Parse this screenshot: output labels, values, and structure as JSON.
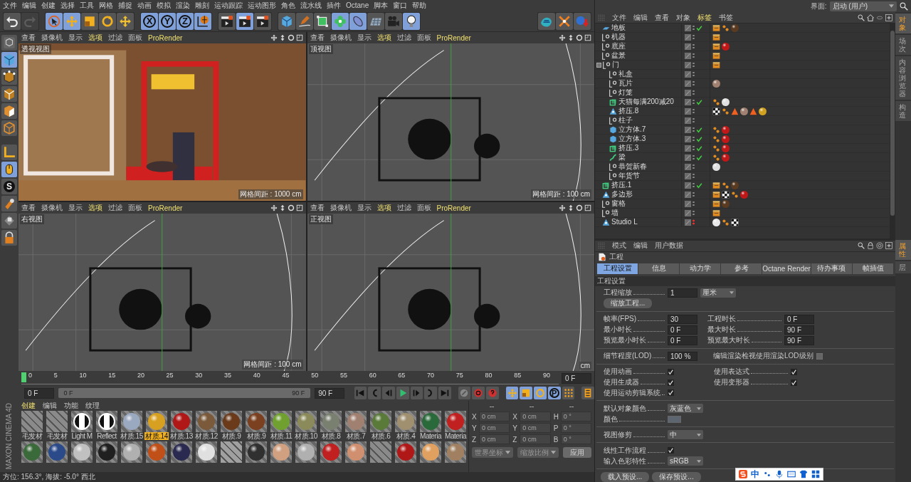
{
  "menu": [
    "文件",
    "编辑",
    "创建",
    "选择",
    "工具",
    "网格",
    "捕捉",
    "动画",
    "模拟",
    "渲染",
    "雕刻",
    "运动跟踪",
    "运动图形",
    "角色",
    "流水线",
    "插件",
    "Octane",
    "脚本",
    "窗口",
    "帮助"
  ],
  "toolbar": [
    {
      "items": [
        {
          "kind": "undo",
          "selected": false,
          "disabled": false
        },
        {
          "kind": "redo",
          "selected": false,
          "disabled": true
        }
      ]
    },
    {
      "items": [
        {
          "kind": "cursor",
          "selected": true,
          "disabled": false
        },
        {
          "kind": "move",
          "selected": true,
          "disabled": false
        },
        {
          "kind": "scale",
          "selected": false,
          "disabled": false
        },
        {
          "kind": "rotate",
          "selected": false,
          "disabled": false
        },
        {
          "kind": "transform",
          "selected": false,
          "disabled": false
        }
      ]
    },
    {
      "items": [
        {
          "kind": "axis",
          "label": "X",
          "selected": true,
          "disabled": false
        },
        {
          "kind": "axis",
          "label": "Y",
          "selected": true,
          "disabled": false
        },
        {
          "kind": "axis",
          "label": "Z",
          "selected": true,
          "disabled": false
        },
        {
          "kind": "world",
          "selected": true,
          "disabled": false
        }
      ]
    },
    {
      "items": [
        {
          "kind": "clapper",
          "selected": false,
          "disabled": false
        },
        {
          "kind": "clapper",
          "selected": true,
          "disabled": false
        },
        {
          "kind": "clapper",
          "selected": false,
          "disabled": false
        }
      ]
    },
    {
      "items": [
        {
          "kind": "cube",
          "selected": false,
          "disabled": false
        },
        {
          "kind": "pen",
          "selected": false,
          "disabled": false
        },
        {
          "kind": "subdiv",
          "selected": false,
          "disabled": false
        },
        {
          "kind": "cloner",
          "selected": true,
          "disabled": false
        },
        {
          "kind": "deformer",
          "selected": true,
          "disabled": false
        },
        {
          "kind": "floor",
          "selected": false,
          "disabled": false
        },
        {
          "kind": "camera",
          "selected": false,
          "disabled": false
        },
        {
          "kind": "bulb",
          "selected": true,
          "disabled": false
        }
      ]
    },
    {
      "items": [
        {
          "kind": "blob",
          "selected": false,
          "disabled": false
        },
        {
          "kind": "snap",
          "selected": false,
          "disabled": false
        },
        {
          "kind": "spherearrow",
          "selected": false,
          "disabled": false
        }
      ]
    }
  ],
  "left_tools": [
    {
      "kind": "viewcube",
      "selected": false
    },
    {
      "kind": "cube",
      "selected": true
    },
    {
      "kind": "points",
      "selected": false
    },
    {
      "kind": "edges",
      "selected": false
    },
    {
      "kind": "polys",
      "selected": false
    },
    {
      "kind": "uvcube",
      "selected": false
    },
    {
      "kind": "axis",
      "selected": false
    },
    {
      "kind": "mouse",
      "selected": true
    },
    {
      "kind": "snap",
      "label": "S",
      "selected": false
    },
    {
      "kind": "magnet",
      "selected": false
    },
    {
      "kind": "lockgrid",
      "selected": false
    },
    {
      "kind": "lock",
      "selected": false
    }
  ],
  "viewports": [
    {
      "title": "透视视图",
      "grid": "网格间距 : 1000 cm",
      "kind": "render",
      "menu": [
        {
          "label": "查看",
          "highlighted": false
        },
        {
          "label": "摄像机",
          "highlighted": false
        },
        {
          "label": "显示",
          "highlighted": false
        },
        {
          "label": "选项",
          "highlighted": true
        },
        {
          "label": "过滤",
          "highlighted": false
        },
        {
          "label": "面板",
          "highlighted": false
        },
        {
          "label": "ProRender",
          "highlighted": true
        }
      ]
    },
    {
      "title": "顶视图",
      "grid": "网格间距 : 100 cm",
      "kind": "wireframe",
      "menu": [
        {
          "label": "查看",
          "highlighted": false
        },
        {
          "label": "摄像机",
          "highlighted": false
        },
        {
          "label": "显示",
          "highlighted": false
        },
        {
          "label": "选项",
          "highlighted": true
        },
        {
          "label": "过滤",
          "highlighted": false
        },
        {
          "label": "面板",
          "highlighted": false
        },
        {
          "label": "ProRender",
          "highlighted": true
        }
      ]
    },
    {
      "title": "右视图",
      "grid": "网格间距 : 100 cm",
      "kind": "wireframe",
      "menu": [
        {
          "label": "查看",
          "highlighted": false
        },
        {
          "label": "摄像机",
          "highlighted": false
        },
        {
          "label": "显示",
          "highlighted": false
        },
        {
          "label": "选项",
          "highlighted": true
        },
        {
          "label": "过滤",
          "highlighted": false
        },
        {
          "label": "面板",
          "highlighted": false
        },
        {
          "label": "ProRender",
          "highlighted": true
        }
      ]
    },
    {
      "title": "正视图",
      "grid": "cm",
      "kind": "wireframe",
      "menu": [
        {
          "label": "查看",
          "highlighted": false
        },
        {
          "label": "摄像机",
          "highlighted": false
        },
        {
          "label": "显示",
          "highlighted": false
        },
        {
          "label": "选项",
          "highlighted": true
        },
        {
          "label": "过滤",
          "highlighted": false
        },
        {
          "label": "面板",
          "highlighted": false
        },
        {
          "label": "ProRender",
          "highlighted": true
        }
      ]
    }
  ],
  "timeline": {
    "ticks": [
      "0",
      "5",
      "10",
      "15",
      "20",
      "25",
      "30",
      "35",
      "40",
      "45",
      "50",
      "55",
      "60",
      "65",
      "70",
      "75",
      "80",
      "85",
      "90"
    ],
    "playhead": {
      "level": 0
    },
    "current": "0 F"
  },
  "transport": {
    "start": "0 F",
    "range_start": "0 F",
    "range_end": "90 F",
    "level": 1,
    "end": "90 F",
    "buttons": [
      {
        "kind": "first",
        "selected": false
      },
      {
        "kind": "prevkey",
        "selected": false
      },
      {
        "kind": "prevframe",
        "selected": false
      },
      {
        "kind": "play",
        "selected": false
      },
      {
        "kind": "nextframe",
        "selected": false
      },
      {
        "kind": "nextkey",
        "selected": false
      },
      {
        "kind": "last",
        "selected": false
      },
      {
        "kind": "recordoff",
        "selected": false
      },
      {
        "kind": "record",
        "selected": false
      },
      {
        "kind": "keyhelp",
        "selected": false
      },
      {
        "kind": "move",
        "selected": true
      },
      {
        "kind": "scale",
        "selected": true
      },
      {
        "kind": "rotate",
        "selected": true
      },
      {
        "kind": "param",
        "label": "P",
        "selected": true
      },
      {
        "kind": "dots",
        "selected": false
      },
      {
        "kind": "timeline",
        "selected": false
      }
    ]
  },
  "materials": {
    "menu": [
      {
        "label": "创建",
        "highlighted": true
      },
      {
        "label": "编辑",
        "highlighted": false
      },
      {
        "label": "功能",
        "highlighted": false
      },
      {
        "label": "纹理",
        "highlighted": false
      }
    ],
    "row_1": [
      {
        "name": "毛发材",
        "kind": "hair",
        "color": "#8a8a8a",
        "selected": false
      },
      {
        "name": "毛发材",
        "kind": "hair",
        "color": "#8a8a8a",
        "selected": false
      },
      {
        "name": "Light M",
        "kind": "bw",
        "color": "#ffffff",
        "selected": false
      },
      {
        "name": "Reflect",
        "kind": "bw",
        "color": "#ffffff",
        "selected": false
      },
      {
        "name": "材质.15",
        "kind": "sphere",
        "color": "#9aa8c0",
        "selected": false
      },
      {
        "name": "材质.14",
        "kind": "sphere",
        "color": "#d8a020",
        "selected": true
      },
      {
        "name": "材质.13",
        "kind": "sphere",
        "color": "#b01818",
        "selected": false
      },
      {
        "name": "材质.12",
        "kind": "sphere",
        "color": "#7a5a3a",
        "selected": false
      },
      {
        "name": "材质.9",
        "kind": "sphere",
        "color": "#6a3a1a",
        "selected": false
      },
      {
        "name": "材质.9",
        "kind": "sphere",
        "color": "#7a4020",
        "selected": false
      },
      {
        "name": "材质.11",
        "kind": "sphere",
        "color": "#70a030",
        "selected": false
      },
      {
        "name": "材质.10",
        "kind": "sphere",
        "color": "#8a8a5a",
        "selected": false
      },
      {
        "name": "材质.8",
        "kind": "sphere",
        "color": "#7a8070",
        "selected": false
      },
      {
        "name": "材质.7",
        "kind": "sphere",
        "color": "#a08070",
        "selected": false
      },
      {
        "name": "材质.6",
        "kind": "sphere",
        "color": "#5a7a3a",
        "selected": false
      },
      {
        "name": "材质.4",
        "kind": "sphere",
        "color": "#a09070",
        "selected": false
      },
      {
        "name": "Materia",
        "kind": "sphere",
        "color": "#2a6a3a",
        "selected": false
      },
      {
        "name": "Materia",
        "kind": "sphere",
        "color": "#c02020",
        "selected": false
      }
    ],
    "row_2": [
      {
        "kind": "sphere",
        "color": "#3a6a3a"
      },
      {
        "kind": "sphere",
        "color": "#2a4a8a"
      },
      {
        "kind": "sphere",
        "color": "#c0c0c0"
      },
      {
        "kind": "sphere",
        "color": "#202020"
      },
      {
        "kind": "sphere",
        "color": "#b0b0b0"
      },
      {
        "kind": "sphere",
        "color": "#c05018"
      },
      {
        "kind": "sphere",
        "color": "#2a2a50"
      },
      {
        "kind": "sphere",
        "color": "#e0e0e0"
      },
      {
        "kind": "hair",
        "color": "#a0a0a0"
      },
      {
        "kind": "sphere",
        "color": "#303030"
      },
      {
        "kind": "sphere",
        "color": "#d0a080"
      },
      {
        "kind": "sphere",
        "color": "#b0b0b0"
      },
      {
        "kind": "sphere",
        "color": "#c02020"
      },
      {
        "kind": "sphere",
        "color": "#d09070"
      },
      {
        "kind": "hair",
        "color": "#8a8a8a"
      },
      {
        "kind": "sphere",
        "color": "#b01818"
      },
      {
        "kind": "sphere",
        "color": "#e0a060"
      },
      {
        "kind": "sphere",
        "color": "#a08060"
      }
    ]
  },
  "coordinates": {
    "headers": [
      "--",
      "--",
      "--"
    ],
    "rows": [
      [
        {
          "axis": "X",
          "value": "0 cm"
        },
        {
          "axis": "X",
          "value": "0 cm"
        },
        {
          "axis": "H",
          "value": "0 °"
        }
      ],
      [
        {
          "axis": "Y",
          "value": "0 cm"
        },
        {
          "axis": "Y",
          "value": "0 cm"
        },
        {
          "axis": "P",
          "value": "0 °"
        }
      ],
      [
        {
          "axis": "Z",
          "value": "0 cm"
        },
        {
          "axis": "Z",
          "value": "0 cm"
        },
        {
          "axis": "B",
          "value": "0 °"
        }
      ]
    ],
    "mode": "世界坐标",
    "scale": "缩放比例",
    "apply": "应用"
  },
  "logo": "MAXON CINEMA 4D",
  "status_bar": "方位: 156.3°, 海拔: -5.0° 西北",
  "layout": {
    "label": "界面:",
    "value": "启动 (用户)"
  },
  "object_manager": {
    "menu": [
      {
        "label": "文件",
        "highlighted": false
      },
      {
        "label": "编辑",
        "highlighted": false
      },
      {
        "label": "查看",
        "highlighted": false
      },
      {
        "label": "对象",
        "highlighted": false
      },
      {
        "label": "标签",
        "highlighted": true
      },
      {
        "label": "书签",
        "highlighted": false
      }
    ],
    "objects": [
      {
        "name": "地板",
        "kind": "plane",
        "checked": true,
        "render_off": false,
        "tags": [
          {
            "kind": "clapper"
          },
          {
            "kind": "dots"
          },
          {
            "kind": "sphere",
            "color": "#5a3a20"
          }
        ]
      },
      {
        "name": "机器",
        "kind": "null",
        "checked": false,
        "render_off": false,
        "tags": [
          {
            "kind": "clapper"
          }
        ]
      },
      {
        "name": "底座",
        "kind": "null",
        "checked": false,
        "render_off": false,
        "tags": [
          {
            "kind": "clapper"
          },
          {
            "kind": "sphere",
            "color": "#c01818"
          }
        ]
      },
      {
        "name": "盆景",
        "kind": "null",
        "checked": false,
        "render_off": false,
        "tags": [
          {
            "kind": "clapper"
          }
        ]
      },
      {
        "name": "门",
        "kind": "null",
        "checked": false,
        "render_off": false,
        "tags": [
          {
            "kind": "clapper"
          }
        ],
        "expanded": true,
        "children": [
          {
            "name": "礼盒",
            "kind": "null",
            "checked": false,
            "render_off": false
          },
          {
            "name": "瓦片",
            "kind": "null",
            "checked": false,
            "render_off": false,
            "tags": [
              {
                "kind": "sphere",
                "color": "#a08070"
              }
            ]
          },
          {
            "name": "灯笼",
            "kind": "null",
            "checked": false,
            "render_off": false
          },
          {
            "name": "天猫每满200减20",
            "kind": "extrude",
            "checked": true,
            "render_off": false,
            "tags": [
              {
                "kind": "dots"
              },
              {
                "kind": "sphere",
                "color": "#e0e0e0"
              }
            ]
          },
          {
            "name": "挤压.8",
            "kind": "polygon",
            "checked": false,
            "render_off": false,
            "tags": [
              {
                "kind": "checker"
              },
              {
                "kind": "dots"
              },
              {
                "kind": "triangle"
              },
              {
                "kind": "sphere",
                "color": "#a08070"
              },
              {
                "kind": "triangle"
              },
              {
                "kind": "sphere",
                "color": "#d0a020"
              }
            ]
          },
          {
            "name": "柱子",
            "kind": "null",
            "checked": false,
            "render_off": false
          },
          {
            "name": "立方体.7",
            "kind": "cube",
            "checked": true,
            "render_off": false,
            "tags": [
              {
                "kind": "dots"
              },
              {
                "kind": "sphere",
                "color": "#c01818"
              }
            ]
          },
          {
            "name": "立方体.3",
            "kind": "cube",
            "checked": true,
            "render_off": false,
            "tags": [
              {
                "kind": "dots"
              },
              {
                "kind": "sphere",
                "color": "#c01818"
              }
            ]
          },
          {
            "name": "挤压.3",
            "kind": "extrude",
            "checked": true,
            "render_off": false,
            "tags": [
              {
                "kind": "dots"
              },
              {
                "kind": "sphere",
                "color": "#c01818"
              }
            ]
          },
          {
            "name": "梁",
            "kind": "spline",
            "checked": true,
            "render_off": false,
            "tags": [
              {
                "kind": "dots"
              },
              {
                "kind": "sphere",
                "color": "#c01818"
              }
            ]
          },
          {
            "name": "恭贺新春",
            "kind": "null",
            "checked": false,
            "render_off": false,
            "tags": [
              {
                "kind": "sphere",
                "color": "#e0e0e0"
              }
            ]
          },
          {
            "name": "年货节",
            "kind": "null",
            "checked": false,
            "render_off": false
          }
        ]
      },
      {
        "name": "挤压.1",
        "kind": "extrude",
        "checked": true,
        "render_off": false,
        "tags": [
          {
            "kind": "clapper"
          },
          {
            "kind": "dots"
          },
          {
            "kind": "sphere",
            "color": "#5a3a20"
          }
        ]
      },
      {
        "name": "多边形",
        "kind": "polygon",
        "checked": false,
        "render_off": false,
        "tags": [
          {
            "kind": "clapper"
          },
          {
            "kind": "checker"
          },
          {
            "kind": "dots"
          },
          {
            "kind": "sphere",
            "color": "#c01818"
          }
        ]
      },
      {
        "name": "窗格",
        "kind": "null",
        "checked": false,
        "render_off": false,
        "tags": [
          {
            "kind": "clapper"
          },
          {
            "kind": "sphere",
            "color": "#5a3a20"
          }
        ]
      },
      {
        "name": "墙",
        "kind": "null",
        "checked": false,
        "render_off": false,
        "tags": [
          {
            "kind": "clapper"
          }
        ]
      },
      {
        "name": "Studio L",
        "kind": "polygon",
        "checked": false,
        "render_off": true,
        "tags": [
          {
            "kind": "sphere",
            "color": "#e8e8e8"
          },
          {
            "kind": "dots"
          },
          {
            "kind": "checker"
          }
        ]
      }
    ],
    "side_tabs": [
      {
        "label": "对象",
        "selected": true
      },
      {
        "label": "场次",
        "selected": false
      },
      {
        "label": "内容浏览器",
        "selected": false
      },
      {
        "label": "构造",
        "selected": false
      }
    ]
  },
  "attributes": {
    "menu": [
      {
        "label": "模式",
        "highlighted": false
      },
      {
        "label": "编辑",
        "highlighted": false
      },
      {
        "label": "用户数据",
        "highlighted": false
      }
    ],
    "title": "工程",
    "tabs": [
      {
        "label": "工程设置",
        "selected": true
      },
      {
        "label": "信息",
        "selected": false
      },
      {
        "label": "动力学",
        "selected": false
      },
      {
        "label": "参考",
        "selected": false
      },
      {
        "label": "Octane Render",
        "selected": false
      },
      {
        "label": "待办事项",
        "selected": false
      },
      {
        "label": "帧插值",
        "selected": false
      }
    ],
    "section": "工程设置",
    "scale": {
      "label": "工程缩放",
      "value": "1",
      "unit": "厘米",
      "button": "缩放工程..."
    },
    "time_fields": [
      [
        {
          "label": "帧率(FPS)",
          "value": "30"
        },
        {
          "label": "工程时长",
          "value": "0 F"
        }
      ],
      [
        {
          "label": "最小时长",
          "value": "0 F"
        },
        {
          "label": "最大时长",
          "value": "90 F"
        }
      ],
      [
        {
          "label": "预览最小时长",
          "value": "0 F"
        },
        {
          "label": "预览最大时长",
          "value": "90 F"
        }
      ]
    ],
    "lod": {
      "label": "细节程度(LOD)",
      "value": "100 %",
      "option": "编辑渲染检视使用渲染LOD级别",
      "checked": false
    },
    "checks": [
      [
        {
          "label": "使用动画",
          "checked": true
        },
        {
          "label": "使用表达式",
          "checked": true
        }
      ],
      [
        {
          "label": "使用生成器",
          "checked": true
        },
        {
          "label": "使用变形器",
          "checked": true
        }
      ],
      [
        {
          "label": "使用运动剪辑系统",
          "checked": true
        }
      ]
    ],
    "default_color": {
      "label": "默认对象颜色",
      "value": "灰蓝色"
    },
    "color": {
      "label": "颜色",
      "color": "#5d6670"
    },
    "view_clip": {
      "label": "视图修剪",
      "value": "中"
    },
    "linear": {
      "label": "线性工作流程",
      "checked": true
    },
    "input_color": {
      "label": "输入色彩特性",
      "value": "sRGB"
    },
    "buttons": [
      "载入预设...",
      "保存预设..."
    ],
    "side_tabs": [
      {
        "label": "属性",
        "selected": true
      },
      {
        "label": "层",
        "selected": false
      }
    ]
  },
  "ime_bar": {
    "mode": "中"
  }
}
